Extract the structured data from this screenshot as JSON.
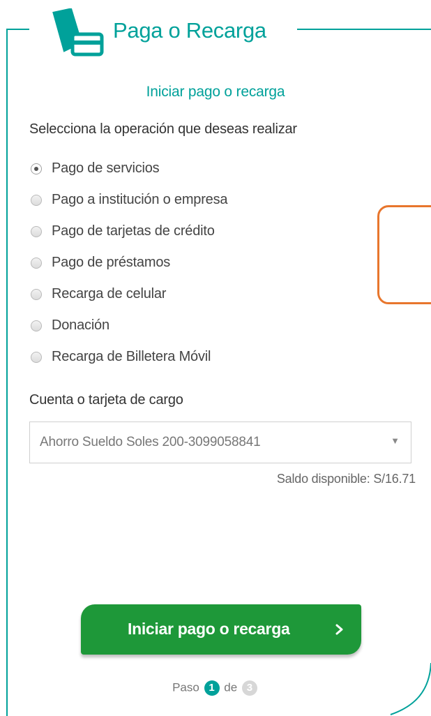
{
  "panel": {
    "title": "Paga o Recarga",
    "icon": "card-payment-icon",
    "accent_color": "#00a19a"
  },
  "form": {
    "subtitle": "Iniciar pago o recarga",
    "prompt": "Selecciona la operación que deseas realizar",
    "operations": [
      {
        "label": "Pago de servicios",
        "selected": true
      },
      {
        "label": "Pago a institución o empresa",
        "selected": false
      },
      {
        "label": "Pago de tarjetas de crédito",
        "selected": false
      },
      {
        "label": "Pago de préstamos",
        "selected": false
      },
      {
        "label": "Recarga de celular",
        "selected": false
      },
      {
        "label": "Donación",
        "selected": false
      },
      {
        "label": "Recarga de Billetera Móvil",
        "selected": false
      }
    ],
    "account_label": "Cuenta o tarjeta de cargo",
    "account_selected": "Ahorro Sueldo Soles 200-3099058841",
    "balance": "Saldo disponible: S/16.71"
  },
  "cta": {
    "label": "Iniciar pago o recarga",
    "color": "#1e9839"
  },
  "steps": {
    "prefix": "Paso",
    "current": "1",
    "middle": "de",
    "total": "3"
  }
}
